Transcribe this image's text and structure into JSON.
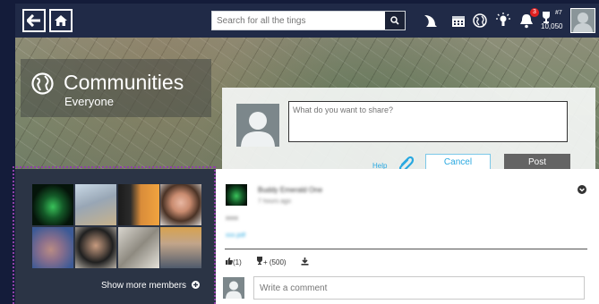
{
  "topbar": {
    "search_placeholder": "Search for all the tings",
    "icons": [
      "back-arrow-icon",
      "home-icon",
      "search-icon",
      "moon-icon",
      "calendar-icon",
      "globe-icon",
      "lightbulb-icon",
      "bell-icon",
      "trophy-icon"
    ],
    "notification_count": "3",
    "rank": "#7",
    "points": "10,050"
  },
  "hero": {
    "title": "Communities",
    "subtitle": "Everyone"
  },
  "share": {
    "placeholder": "What do you want to share?",
    "help_label": "Help",
    "cancel_label": "Cancel",
    "post_label": "Post"
  },
  "members": {
    "show_more_label": "Show more members"
  },
  "feed": {
    "post_author": "Buddy Emerald One",
    "post_time": "7 hours ago",
    "post_line1": "xxxx",
    "post_line2": "xxx.pdf",
    "likes_label": "(1)",
    "award_label": "+ (500)",
    "comment_placeholder": "Write a comment"
  },
  "colors": {
    "topbar": "#202a47",
    "accent": "#29a8e0",
    "page_background": "#141c3a",
    "frame_marker": "#8e3fa7"
  }
}
